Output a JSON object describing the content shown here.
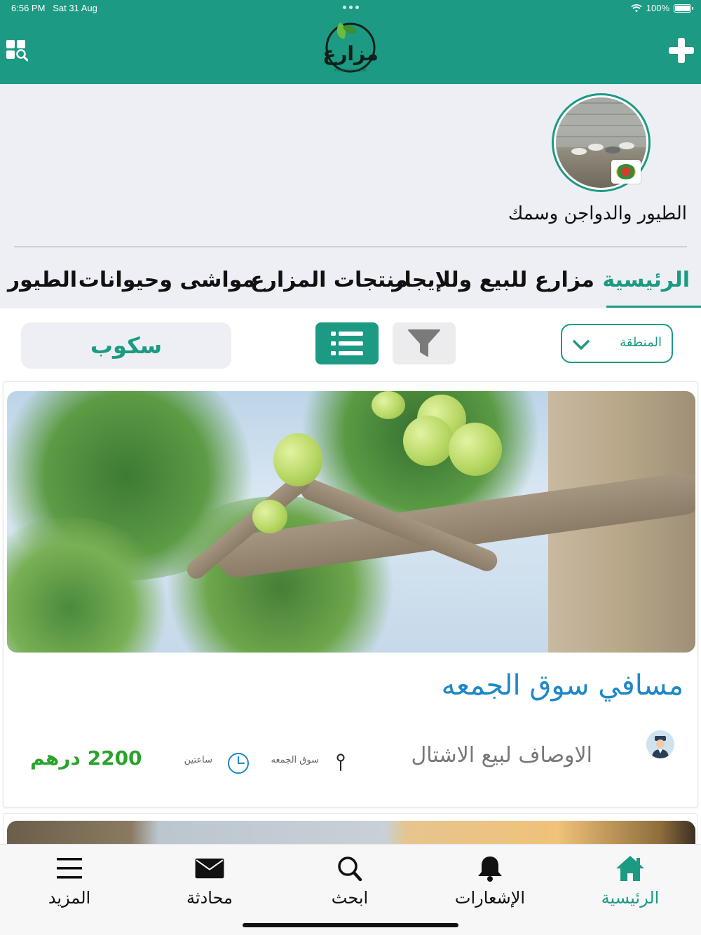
{
  "status_bar": {
    "time": "6:56 PM",
    "date": "Sat 31 Aug",
    "battery": "100%"
  },
  "header": {
    "logo_text": "مزارع",
    "logo_subtext": "FARMSHOPS.COM",
    "left_icon": "grid-search-icon",
    "right_icon": "plus-icon",
    "brand_color": "#1c9a83"
  },
  "category": {
    "title": "الطيور والدواجن وسمك",
    "badge_icon": "farm-logo-badge"
  },
  "tabs": [
    {
      "label": "الرئيسية",
      "active": true
    },
    {
      "label": "مزارع للبيع وللإيجار",
      "active": false
    },
    {
      "label": "منتجات المزارع",
      "active": false
    },
    {
      "label": "مواشى وحيوانات",
      "active": false
    },
    {
      "label": "الطيور وا",
      "active": false
    }
  ],
  "toolbar": {
    "region_label": "المنطقة",
    "filter_icon": "funnel-icon",
    "list_view_icon": "list-icon",
    "search_value": "سكوب"
  },
  "listing": {
    "title": "مسافي سوق الجمعه",
    "description": "الاوصاف لبيع الاشتال",
    "location": "سوق الجمعه",
    "time_ago": "ساعتين",
    "price": "2200 درهم",
    "price_color": "#2aa32a",
    "title_color": "#1e88c7"
  },
  "bottom_nav": [
    {
      "label": "الرئيسية",
      "icon": "home-icon",
      "active": true
    },
    {
      "label": "الإشعارات",
      "icon": "bell-icon",
      "active": false
    },
    {
      "label": "ابحث",
      "icon": "search-icon",
      "active": false
    },
    {
      "label": "محادثة",
      "icon": "envelope-icon",
      "active": false
    },
    {
      "label": "المزيد",
      "icon": "menu-icon",
      "active": false
    }
  ]
}
